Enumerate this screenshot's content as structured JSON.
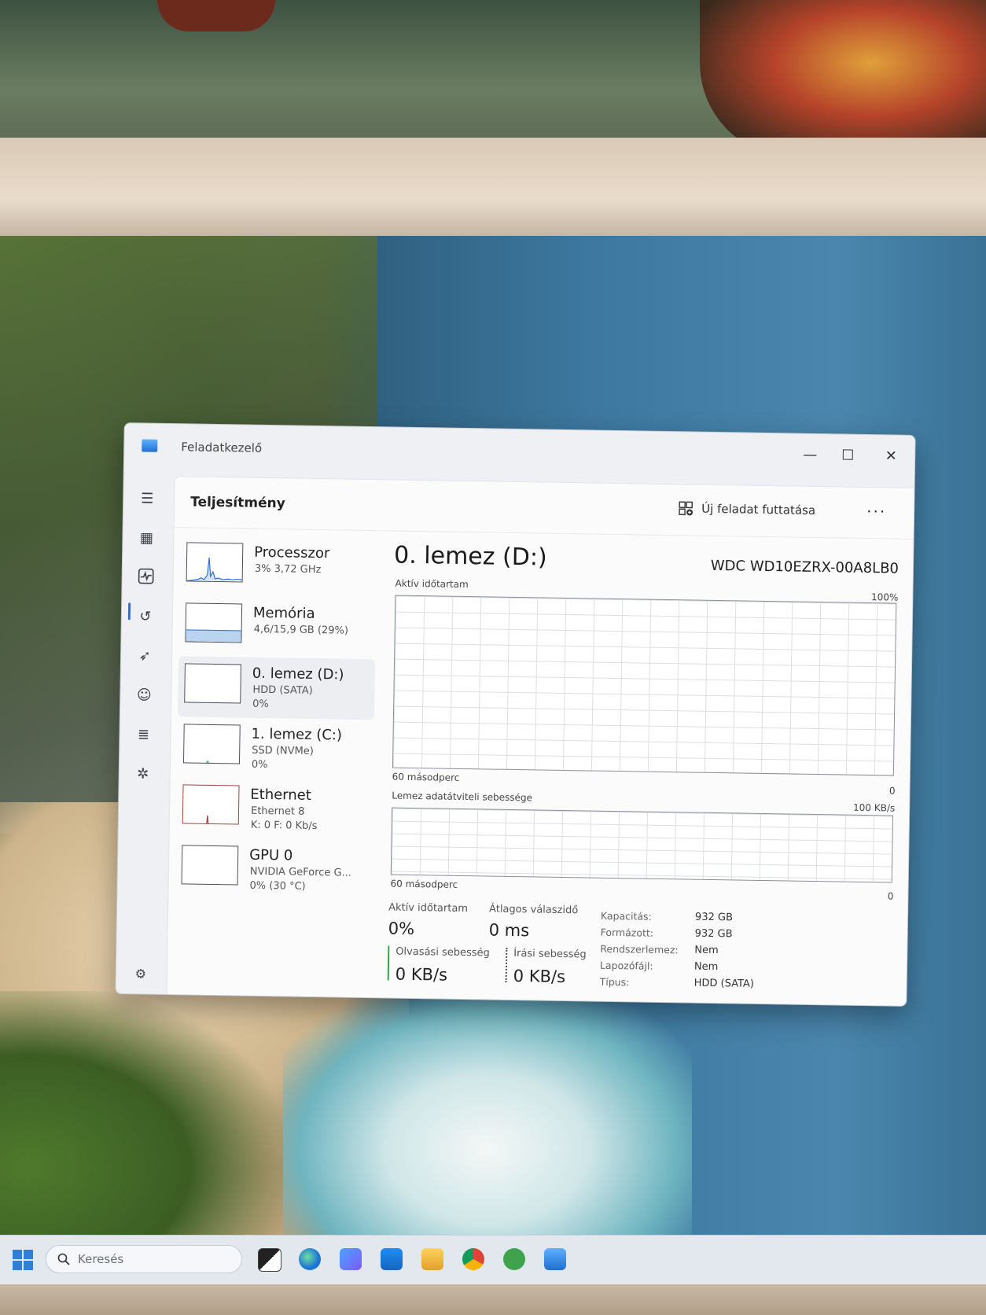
{
  "window": {
    "title": "Feladatkezelő",
    "minimize_glyph": "—",
    "maximize_glyph": "☐",
    "close_glyph": "✕"
  },
  "rail": {
    "icons": [
      "hamburger-icon",
      "processes-icon",
      "performance-icon",
      "app-history-icon",
      "startup-icon",
      "users-icon",
      "details-icon",
      "services-icon",
      "settings-icon"
    ]
  },
  "header": {
    "title": "Teljesítmény",
    "run_task_label": "Új feladat futtatása",
    "more_label": "···"
  },
  "devices": [
    {
      "name": "Processzor",
      "sub": "3% 3,72 GHz",
      "sub2": ""
    },
    {
      "name": "Memória",
      "sub": "4,6/15,9 GB (29%)",
      "sub2": ""
    },
    {
      "name": "0. lemez (D:)",
      "sub": "HDD (SATA)",
      "sub2": "0%"
    },
    {
      "name": "1. lemez (C:)",
      "sub": "SSD (NVMe)",
      "sub2": "0%"
    },
    {
      "name": "Ethernet",
      "sub": "Ethernet 8",
      "sub2": "K: 0 F: 0 Kb/s"
    },
    {
      "name": "GPU 0",
      "sub": "NVIDIA GeForce G...",
      "sub2": "0% (30 °C)"
    }
  ],
  "detail": {
    "title": "0. lemez (D:)",
    "model": "WDC WD10EZRX-00A8LB0",
    "graph1": {
      "label": "Aktív időtartam",
      "max": "100%",
      "time": "60 másodperc",
      "min": "0"
    },
    "graph2": {
      "label": "Lemez adatátviteli sebessége",
      "max": "100 KB/s",
      "time": "60 másodperc",
      "min": "0"
    },
    "stats": {
      "active_label": "Aktív időtartam",
      "active_value": "0%",
      "avg_label": "Átlagos válaszidő",
      "avg_value": "0 ms",
      "read_label": "Olvasási sebesség",
      "read_value": "0 KB/s",
      "write_label": "Írási sebesség",
      "write_value": "0 KB/s"
    },
    "properties": [
      {
        "k": "Kapacitás:",
        "v": "932 GB"
      },
      {
        "k": "Formázott:",
        "v": "932 GB"
      },
      {
        "k": "Rendszerlemez:",
        "v": "Nem"
      },
      {
        "k": "Lapozófájl:",
        "v": "Nem"
      },
      {
        "k": "Típus:",
        "v": "HDD (SATA)"
      }
    ]
  },
  "taskbar": {
    "search_placeholder": "Keresés",
    "apps": [
      "task-view-icon",
      "edge-icon",
      "copilot-icon",
      "store-icon",
      "file-explorer-icon",
      "chrome-icon",
      "utorrent-icon",
      "task-manager-icon"
    ]
  },
  "colors": {
    "accent": "#2f6fd8",
    "read_bar": "#3aa34a",
    "write_bar": "#4a4f57"
  }
}
